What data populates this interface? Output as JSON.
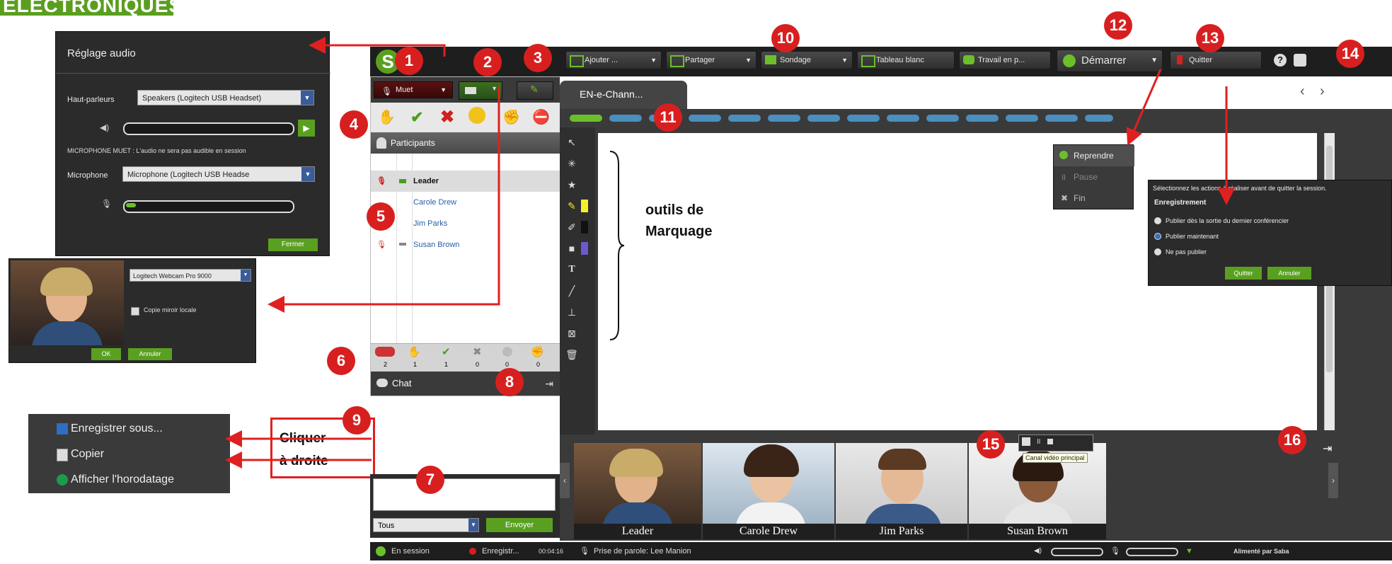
{
  "header": {
    "logo_text": "ÉLECTRONIQUES"
  },
  "callouts": [
    "1",
    "2",
    "3",
    "4",
    "5",
    "6",
    "7",
    "8",
    "9",
    "10",
    "11",
    "12",
    "13",
    "14",
    "15",
    "16"
  ],
  "toolbar": {
    "mute_label": "Muet",
    "add_label": "Ajouter ...",
    "share_label": "Partager",
    "poll_label": "Sondage",
    "whiteboard_label": "Tableau blanc",
    "breakout_label": "Travail en p...",
    "start_label": "Démarrer",
    "quit_label": "Quitter"
  },
  "tab": {
    "label": "EN-e-Chann..."
  },
  "participants": {
    "header": "Participants",
    "rows": [
      {
        "name": "Leader"
      },
      {
        "name": "Carole Drew"
      },
      {
        "name": "Jim Parks"
      },
      {
        "name": "Susan Brown"
      }
    ],
    "counts": [
      "2",
      "1",
      "1",
      "0",
      "0",
      "0"
    ]
  },
  "chat": {
    "label": "Chat",
    "recipient": "Tous",
    "send_label": "Envoyer"
  },
  "audio_panel": {
    "title": "Réglage audio",
    "speakers_label": "Haut-parleurs",
    "speakers_value": "Speakers (Logitech USB Headset)",
    "mic_muted_note": "MICROPHONE MUET : L'audio ne sera pas audible en session",
    "mic_label": "Microphone",
    "mic_value": "Microphone (Logitech USB Headse",
    "close_label": "Fermer"
  },
  "webcam_panel": {
    "camera_value": "Logitech Webcam Pro 9000",
    "mirror_label": "Copie miroir locale",
    "ok_label": "OK",
    "cancel_label": "Annuler"
  },
  "context_menu": {
    "items": [
      "Enregistrer sous...",
      "Copier",
      "Afficher l'horodatage"
    ],
    "note_line1": "Cliquer",
    "note_line2": "à droite"
  },
  "whiteboard": {
    "annotation_line1": "outils de",
    "annotation_line2": "Marquage"
  },
  "start_menu": {
    "items": [
      "Reprendre",
      "Pause",
      "Fin"
    ]
  },
  "quit_dialog": {
    "prompt": "Sélectionnez les actions à réaliser avant de quitter la session.",
    "section": "Enregistrement",
    "options": [
      "Publier dès la sortie du dernier conférencier",
      "Publier maintenant",
      "Ne pas publier"
    ],
    "quit_label": "Quitter",
    "cancel_label": "Annuler"
  },
  "video_strip": {
    "labels": [
      "Leader",
      "Carole Drew",
      "Jim Parks",
      "Susan Brown"
    ],
    "tooltip": "Canal vidéo principal"
  },
  "status_bar": {
    "session": "En session",
    "recording": "Enregistr...",
    "time": "00:04:16",
    "speaker": "Prise de parole: Lee Manion",
    "powered": "Alimenté par Saba"
  },
  "colors": {
    "accent_green": "#5a9e1f",
    "callout_red": "#d81f1f",
    "arrow_red": "#e02020",
    "dark_panel": "#2b2b2b"
  }
}
